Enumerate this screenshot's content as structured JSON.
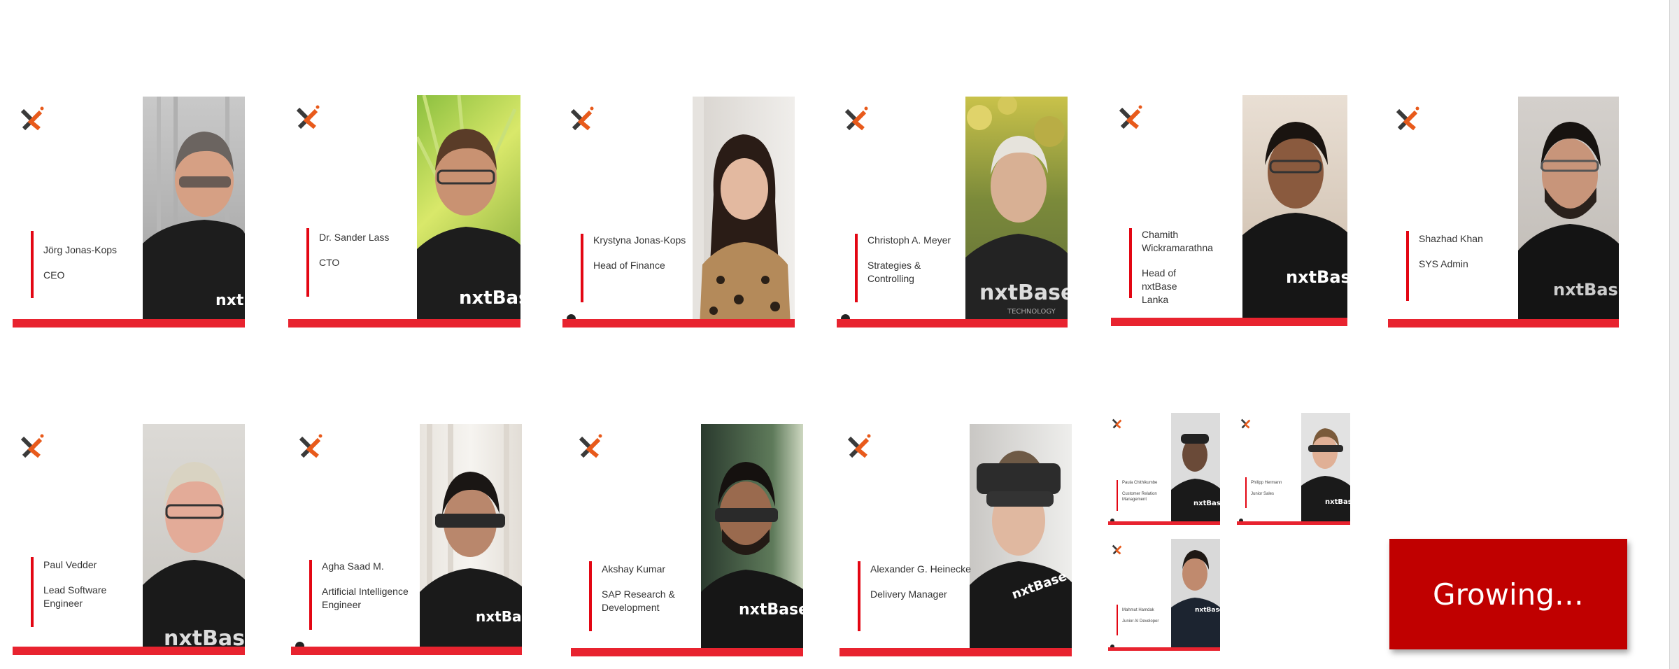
{
  "colors": {
    "accent_red": "#e8232f",
    "logo_orange": "#e85a1b",
    "growing_bg": "#c00000"
  },
  "cards": [
    {
      "name": "Jörg Jonas-Kops",
      "title": "CEO"
    },
    {
      "name": "Dr. Sander Lass",
      "title": "CTO"
    },
    {
      "name": "Krystyna Jonas-Kops",
      "title": "Head of Finance"
    },
    {
      "name": "Christoph A. Meyer",
      "title": "Strategies & Controlling"
    },
    {
      "name": "Chamith Wickramarathna",
      "title": "Head of nxtBase Lanka"
    },
    {
      "name": "Shazhad Khan",
      "title": "SYS Admin"
    },
    {
      "name": "Paul Vedder",
      "title": "Lead Software Engineer"
    },
    {
      "name": "Agha Saad M.",
      "title": "Artificial Intelligence Engineer"
    },
    {
      "name": "Akshay Kumar",
      "title": "SAP Research & Development"
    },
    {
      "name": "Alexander G. Heinecke",
      "title": "Delivery Manager"
    }
  ],
  "small_cards": [
    {
      "name": "Paula Chithikumbe",
      "title": "Customer Relation Management"
    },
    {
      "name": "Philipp Hermann",
      "title": "Junior Sales"
    },
    {
      "name": "Mahmut Hamdak",
      "title": "Junior AI Developer"
    }
  ],
  "shirt_logo": "nxtBase",
  "shirt_sub": "TECHNOLOGY",
  "growing_label": "Growing…"
}
